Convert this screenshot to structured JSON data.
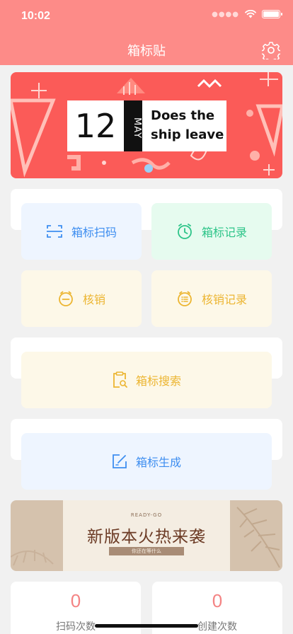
{
  "status": {
    "time": "10:02"
  },
  "header": {
    "title": "箱标贴",
    "settings_icon": "gear-icon"
  },
  "banner_top": {
    "day": "12",
    "month": "MAY",
    "line1": "Does the",
    "line2": "ship leave",
    "bg_color": "#fb5b58"
  },
  "menu": {
    "scan_label": "箱标扫码",
    "records_label": "箱标记录",
    "writeoff_label": "核销",
    "writeoff_records_label": "核销记录",
    "search_label": "箱标搜索",
    "generate_label": "箱标生成"
  },
  "banner_bottom": {
    "tag": "READY-GO",
    "title": "新版本火热来袭",
    "subtitle": "你还在等什么"
  },
  "stats": [
    {
      "value": "0",
      "label": "扫码次数"
    },
    {
      "value": "0",
      "label": "创建次数"
    }
  ],
  "colors": {
    "header": "#fd8b88",
    "blue": "#3e8ef0",
    "green": "#2cc488",
    "yellow": "#ecb531",
    "stat_number": "#f48484"
  }
}
